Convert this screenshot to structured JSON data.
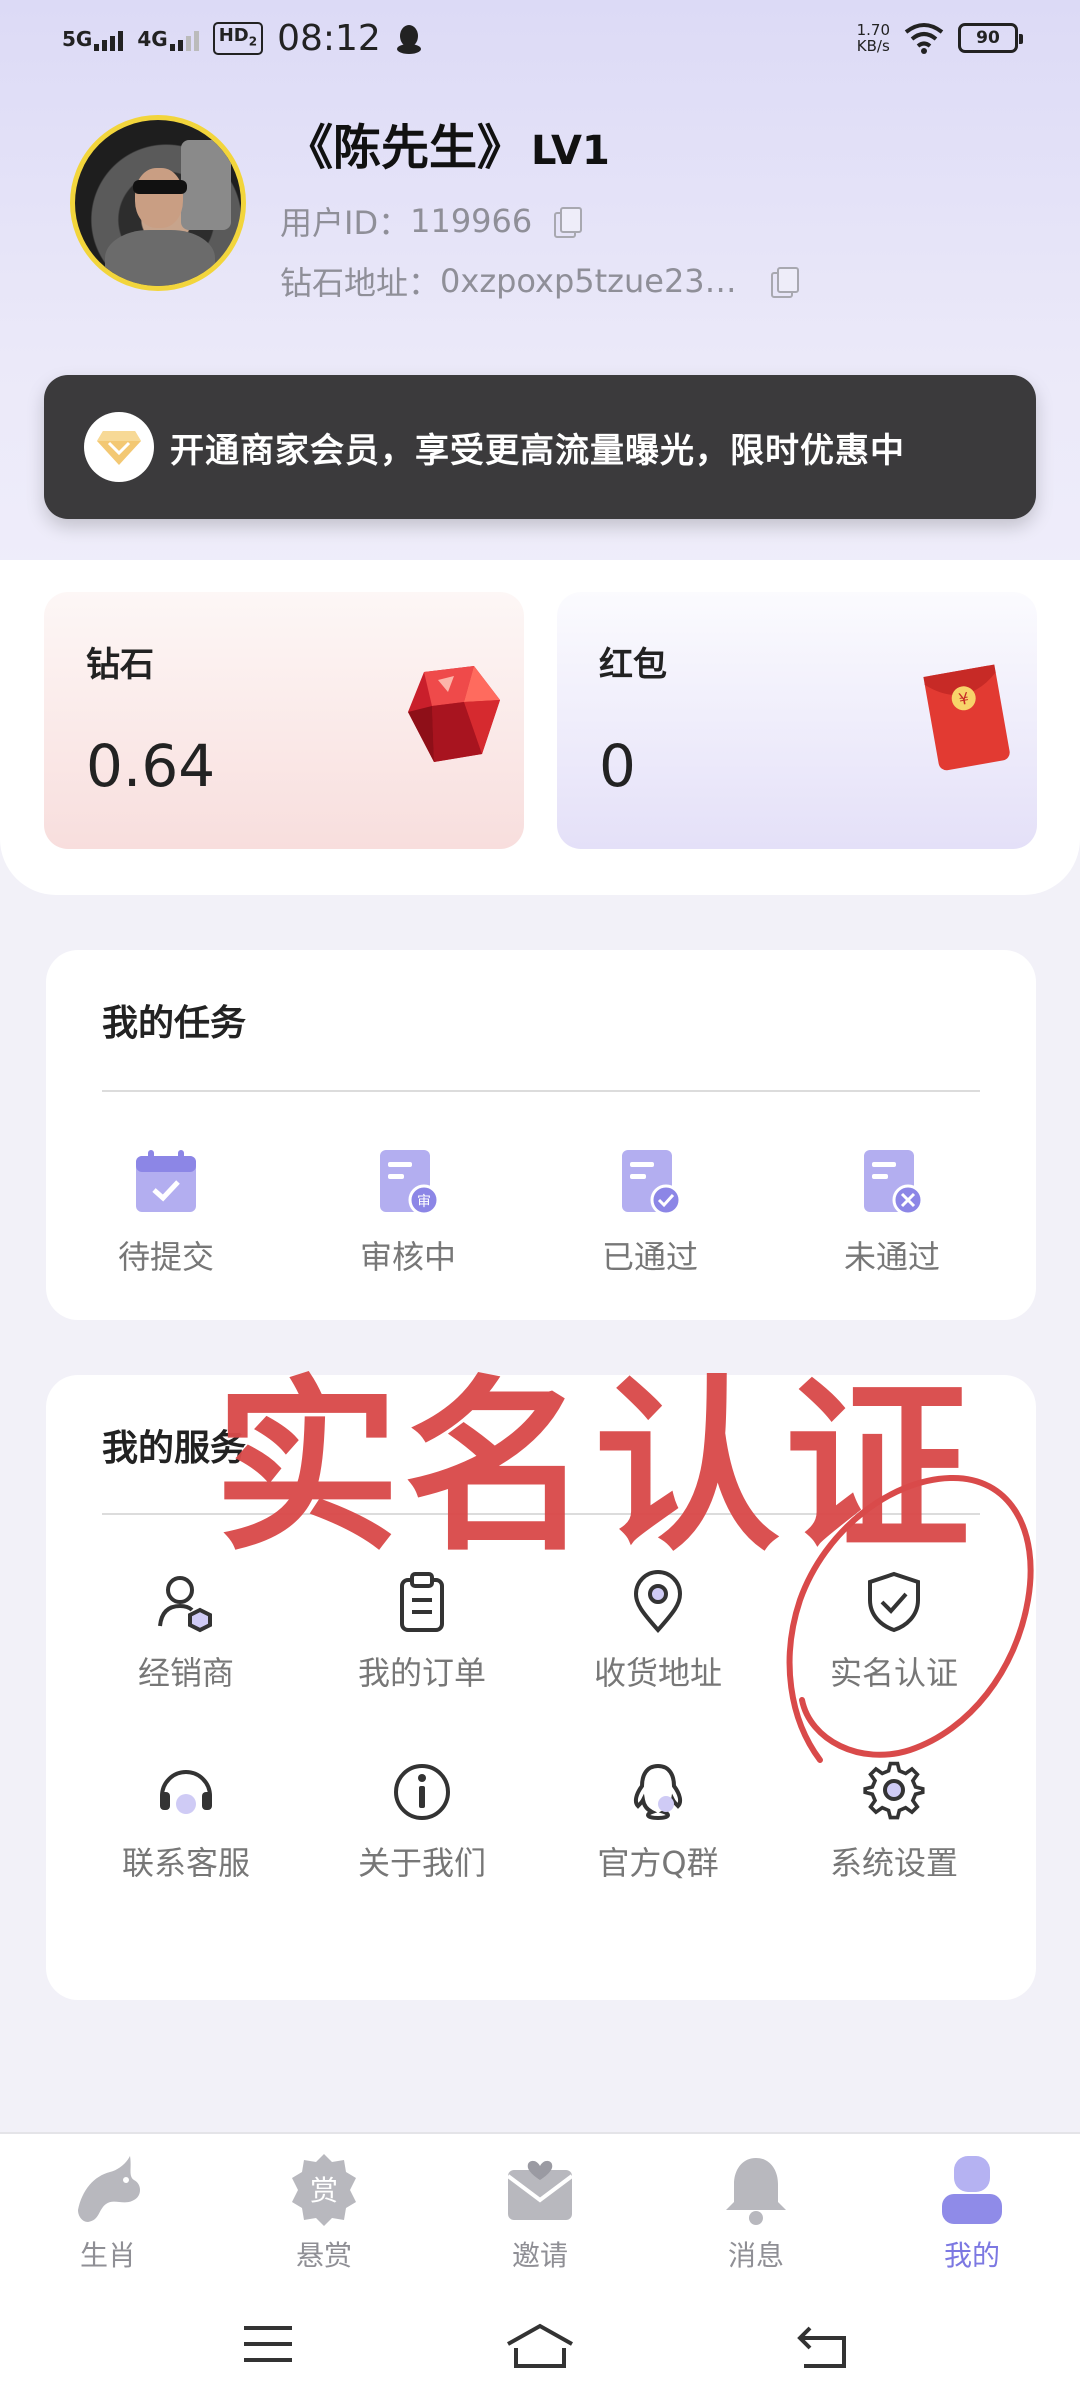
{
  "status_bar": {
    "net1": "5G",
    "net2": "4G",
    "hd": "HD",
    "hd_sub": "2",
    "time": "08:12",
    "speed_value": "1.70",
    "speed_unit": "KB/s",
    "battery": "90"
  },
  "profile": {
    "name": "《陈先生》",
    "level": "LV1",
    "user_id_label": "用户ID：",
    "user_id": "119966",
    "address_label": "钻石地址：",
    "address": "0xzpoxp5tzue23…"
  },
  "vip_banner": {
    "text": "开通商家会员，享受更高流量曝光，限时优惠中"
  },
  "wallet": {
    "diamond_label": "钻石",
    "diamond_value": "0.64",
    "redpack_label": "红包",
    "redpack_value": "0"
  },
  "tasks": {
    "title": "我的任务",
    "items": [
      {
        "label": "待提交",
        "icon": "calendar-check-icon"
      },
      {
        "label": "审核中",
        "icon": "doc-review-icon"
      },
      {
        "label": "已通过",
        "icon": "doc-approved-icon"
      },
      {
        "label": "未通过",
        "icon": "doc-rejected-icon"
      }
    ]
  },
  "services": {
    "title": "我的服务",
    "items": [
      {
        "label": "经销商",
        "icon": "dealer-icon"
      },
      {
        "label": "我的订单",
        "icon": "clipboard-icon"
      },
      {
        "label": "收货地址",
        "icon": "location-pin-icon"
      },
      {
        "label": "实名认证",
        "icon": "shield-check-icon"
      },
      {
        "label": "联系客服",
        "icon": "headset-icon"
      },
      {
        "label": "关于我们",
        "icon": "info-icon"
      },
      {
        "label": "官方Q群",
        "icon": "qq-penguin-icon"
      },
      {
        "label": "系统设置",
        "icon": "gear-icon"
      }
    ]
  },
  "annotation": {
    "text": "实名认证",
    "color": "#d94a4a"
  },
  "bottom_nav": {
    "items": [
      {
        "label": "生肖",
        "icon": "dragon-icon"
      },
      {
        "label": "悬赏",
        "icon": "reward-badge-icon"
      },
      {
        "label": "邀请",
        "icon": "invite-envelope-icon"
      },
      {
        "label": "消息",
        "icon": "bell-icon"
      },
      {
        "label": "我的",
        "icon": "profile-icon"
      }
    ],
    "active_index": 4,
    "active_color": "#7c78e2"
  },
  "colors": {
    "accent": "#7c78e2",
    "banner_bg": "#3b3a3c",
    "diamond_red": "#e02b2b"
  }
}
